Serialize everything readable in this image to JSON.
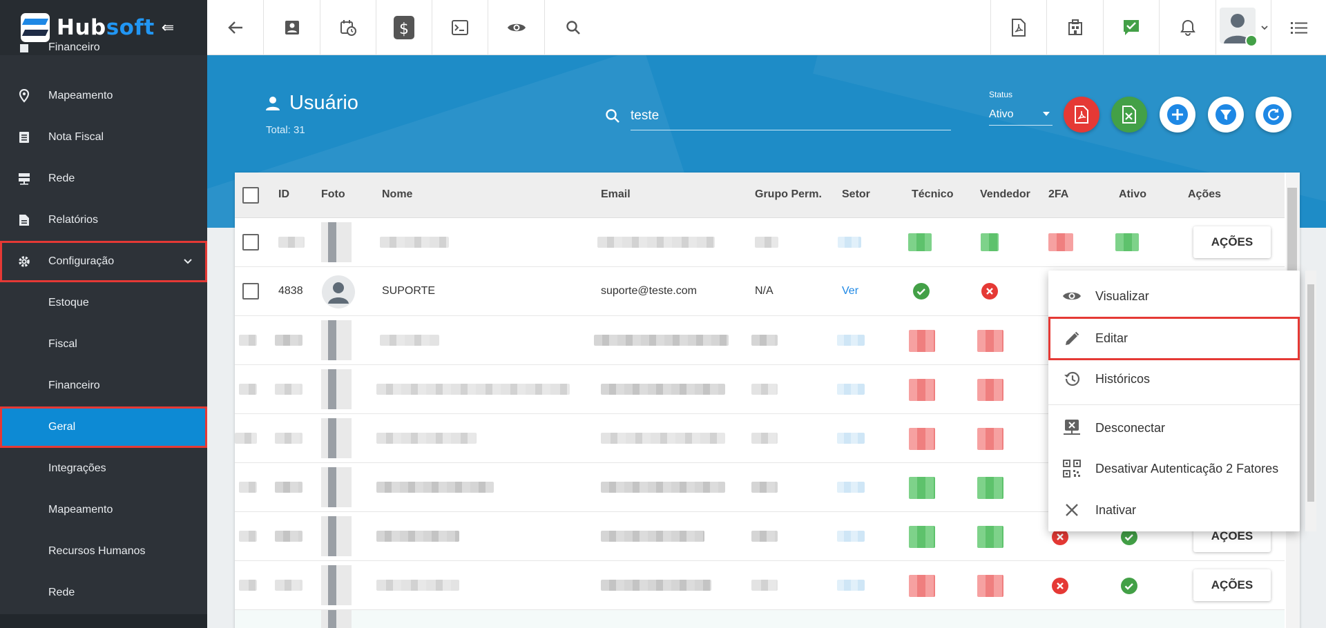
{
  "brand": {
    "hub": "Hub",
    "soft": "soft"
  },
  "sidebar": {
    "items": [
      {
        "label": "Financeiro",
        "icon": "money-icon"
      },
      {
        "label": "Mapeamento",
        "icon": "map-pin-icon"
      },
      {
        "label": "Nota Fiscal",
        "icon": "document-list-icon"
      },
      {
        "label": "Rede",
        "icon": "server-icon"
      },
      {
        "label": "Relatórios",
        "icon": "report-icon"
      },
      {
        "label": "Configuração",
        "icon": "gear-icon",
        "expanded": true
      }
    ],
    "subitems": [
      {
        "label": "Estoque"
      },
      {
        "label": "Fiscal"
      },
      {
        "label": "Financeiro"
      },
      {
        "label": "Geral",
        "active": true
      },
      {
        "label": "Integrações"
      },
      {
        "label": "Mapeamento"
      },
      {
        "label": "Recursos Humanos"
      },
      {
        "label": "Rede"
      }
    ]
  },
  "page": {
    "title": "Usuário",
    "total": "Total: 31",
    "search_value": "teste",
    "status_label": "Status",
    "status_value": "Ativo"
  },
  "table": {
    "headers": [
      "ID",
      "Foto",
      "Nome",
      "Email",
      "Grupo Perm.",
      "Setor",
      "Técnico",
      "Vendedor",
      "2FA",
      "Ativo",
      "Ações"
    ],
    "visible_row": {
      "id": "4838",
      "name": "SUPORTE",
      "email": "suporte@teste.com",
      "group": "N/A",
      "sector_link": "Ver"
    },
    "action_label": "AÇÕES"
  },
  "menu": {
    "items": [
      {
        "label": "Visualizar",
        "icon": "eye-icon"
      },
      {
        "label": "Editar",
        "icon": "pencil-icon",
        "highlighted": true
      },
      {
        "label": "Históricos",
        "icon": "history-icon"
      },
      {
        "label": "Desconectar",
        "icon": "disconnect-icon"
      },
      {
        "label": "Desativar Autenticação 2 Fatores",
        "icon": "qr-code-icon"
      },
      {
        "label": "Inativar",
        "icon": "close-icon"
      }
    ]
  },
  "colors": {
    "sidebar_bg": "#2d3238",
    "header_bg": "#1e8cc7",
    "active_item": "#0d8ad4",
    "highlight": "#e53935",
    "success": "#43a047",
    "danger": "#e53935",
    "brand_blue": "#2196f3"
  }
}
